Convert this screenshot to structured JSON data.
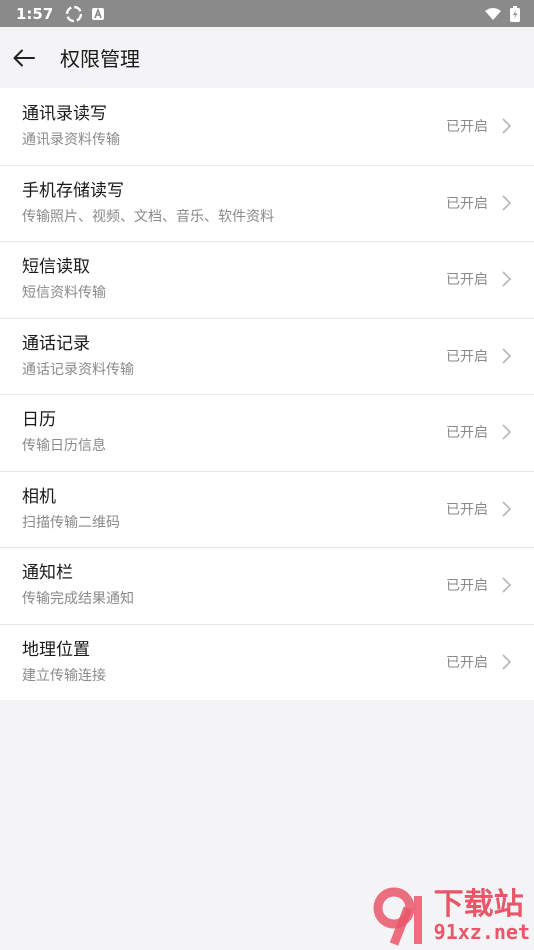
{
  "status_bar": {
    "time": "1:57"
  },
  "appbar": {
    "title": "权限管理"
  },
  "permissions": [
    {
      "title": "通讯录读写",
      "subtitle": "通讯录资料传输",
      "status": "已开启"
    },
    {
      "title": "手机存储读写",
      "subtitle": "传输照片、视频、文档、音乐、软件资料",
      "status": "已开启"
    },
    {
      "title": "短信读取",
      "subtitle": "短信资料传输",
      "status": "已开启"
    },
    {
      "title": "通话记录",
      "subtitle": "通话记录资料传输",
      "status": "已开启"
    },
    {
      "title": "日历",
      "subtitle": "传输日历信息",
      "status": "已开启"
    },
    {
      "title": "相机",
      "subtitle": "扫描传输二维码",
      "status": "已开启"
    },
    {
      "title": "通知栏",
      "subtitle": "传输完成结果通知",
      "status": "已开启"
    },
    {
      "title": "地理位置",
      "subtitle": "建立传输连接",
      "status": "已开启"
    }
  ],
  "watermark": {
    "brand": "下载站",
    "url": "91xz.net"
  }
}
